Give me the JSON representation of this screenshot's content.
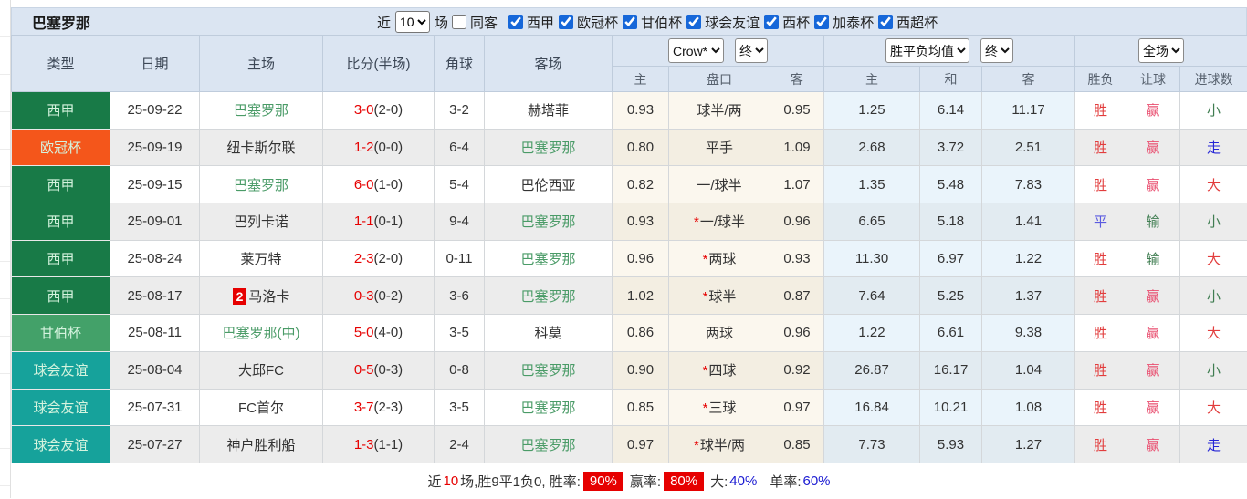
{
  "title": "巴塞罗那",
  "filters": {
    "near_label": "近",
    "near_value": "10",
    "matches_label": "场",
    "same_away": {
      "label": "同客",
      "checked": false
    },
    "leagues": [
      {
        "label": "西甲",
        "checked": true
      },
      {
        "label": "欧冠杯",
        "checked": true
      },
      {
        "label": "甘伯杯",
        "checked": true
      },
      {
        "label": "球会友谊",
        "checked": true
      },
      {
        "label": "西杯",
        "checked": true
      },
      {
        "label": "加泰杯",
        "checked": true
      },
      {
        "label": "西超杯",
        "checked": true
      }
    ]
  },
  "selectors": {
    "provider": "Crow*",
    "provider_time": "终",
    "avg_metric": "胜平负均值",
    "avg_time": "终",
    "scope": "全场"
  },
  "columns": {
    "type": "类型",
    "date": "日期",
    "home": "主场",
    "score": "比分(半场)",
    "corner": "角球",
    "away": "客场",
    "sub": [
      "主",
      "盘口",
      "客",
      "主",
      "和",
      "客",
      "胜负",
      "让球",
      "进球数"
    ]
  },
  "colors": {
    "laliga": "#187a47",
    "ucl": "#f4561b",
    "gamper": "#43a169",
    "friendly": "#16a29b",
    "type_text": "#d5f3de",
    "team_highlight": "#4a9b67",
    "score_red": "#e60000",
    "result_red": "#e23d3d",
    "result_pink": "#e94f70",
    "result_green": "#3f7d51",
    "result_blue": "#5b5be0",
    "result_go_blue": "#2424d6",
    "rate_badge_bg": "#e60000",
    "rate_blue": "#1a1ad2",
    "header_bg": "#dbe5f2"
  },
  "rows": [
    {
      "type": {
        "label": "西甲",
        "key": "laliga"
      },
      "date": "25-09-22",
      "home": {
        "name": "巴塞罗那",
        "highlight": true,
        "badge": ""
      },
      "score": {
        "full": "3-0",
        "half": "(2-0)"
      },
      "corner": "3-2",
      "away": {
        "name": "赫塔菲",
        "highlight": false
      },
      "crow": {
        "home": "0.93",
        "line": "球半/两",
        "star": false,
        "away": "0.95"
      },
      "avg": {
        "home": "1.25",
        "draw": "6.14",
        "away": "11.17"
      },
      "result": {
        "outcome": {
          "t": "胜",
          "c": "red"
        },
        "handicap": {
          "t": "赢",
          "c": "pink"
        },
        "goals": {
          "t": "小",
          "c": "green"
        }
      }
    },
    {
      "type": {
        "label": "欧冠杯",
        "key": "ucl"
      },
      "date": "25-09-19",
      "home": {
        "name": "纽卡斯尔联",
        "highlight": false,
        "badge": ""
      },
      "score": {
        "full": "1-2",
        "half": "(0-0)"
      },
      "corner": "6-4",
      "away": {
        "name": "巴塞罗那",
        "highlight": true
      },
      "crow": {
        "home": "0.80",
        "line": "平手",
        "star": false,
        "away": "1.09"
      },
      "avg": {
        "home": "2.68",
        "draw": "3.72",
        "away": "2.51"
      },
      "result": {
        "outcome": {
          "t": "胜",
          "c": "red"
        },
        "handicap": {
          "t": "赢",
          "c": "pink"
        },
        "goals": {
          "t": "走",
          "c": "go"
        }
      }
    },
    {
      "type": {
        "label": "西甲",
        "key": "laliga"
      },
      "date": "25-09-15",
      "home": {
        "name": "巴塞罗那",
        "highlight": true,
        "badge": ""
      },
      "score": {
        "full": "6-0",
        "half": "(1-0)"
      },
      "corner": "5-4",
      "away": {
        "name": "巴伦西亚",
        "highlight": false
      },
      "crow": {
        "home": "0.82",
        "line": "一/球半",
        "star": false,
        "away": "1.07"
      },
      "avg": {
        "home": "1.35",
        "draw": "5.48",
        "away": "7.83"
      },
      "result": {
        "outcome": {
          "t": "胜",
          "c": "red"
        },
        "handicap": {
          "t": "赢",
          "c": "pink"
        },
        "goals": {
          "t": "大",
          "c": "red"
        }
      }
    },
    {
      "type": {
        "label": "西甲",
        "key": "laliga"
      },
      "date": "25-09-01",
      "home": {
        "name": "巴列卡诺",
        "highlight": false,
        "badge": ""
      },
      "score": {
        "full": "1-1",
        "half": "(0-1)"
      },
      "corner": "9-4",
      "away": {
        "name": "巴塞罗那",
        "highlight": true
      },
      "crow": {
        "home": "0.93",
        "line": "一/球半",
        "star": true,
        "away": "0.96"
      },
      "avg": {
        "home": "6.65",
        "draw": "5.18",
        "away": "1.41"
      },
      "result": {
        "outcome": {
          "t": "平",
          "c": "blue"
        },
        "handicap": {
          "t": "输",
          "c": "green"
        },
        "goals": {
          "t": "小",
          "c": "green"
        }
      }
    },
    {
      "type": {
        "label": "西甲",
        "key": "laliga"
      },
      "date": "25-08-24",
      "home": {
        "name": "莱万特",
        "highlight": false,
        "badge": ""
      },
      "score": {
        "full": "2-3",
        "half": "(2-0)"
      },
      "corner": "0-11",
      "away": {
        "name": "巴塞罗那",
        "highlight": true
      },
      "crow": {
        "home": "0.96",
        "line": "两球",
        "star": true,
        "away": "0.93"
      },
      "avg": {
        "home": "11.30",
        "draw": "6.97",
        "away": "1.22"
      },
      "result": {
        "outcome": {
          "t": "胜",
          "c": "red"
        },
        "handicap": {
          "t": "输",
          "c": "green"
        },
        "goals": {
          "t": "大",
          "c": "red"
        }
      }
    },
    {
      "type": {
        "label": "西甲",
        "key": "laliga"
      },
      "date": "25-08-17",
      "home": {
        "name": "马洛卡",
        "highlight": false,
        "badge": "2"
      },
      "score": {
        "full": "0-3",
        "half": "(0-2)"
      },
      "corner": "3-6",
      "away": {
        "name": "巴塞罗那",
        "highlight": true
      },
      "crow": {
        "home": "1.02",
        "line": "球半",
        "star": true,
        "away": "0.87"
      },
      "avg": {
        "home": "7.64",
        "draw": "5.25",
        "away": "1.37"
      },
      "result": {
        "outcome": {
          "t": "胜",
          "c": "red"
        },
        "handicap": {
          "t": "赢",
          "c": "pink"
        },
        "goals": {
          "t": "小",
          "c": "green"
        }
      }
    },
    {
      "type": {
        "label": "甘伯杯",
        "key": "gamper"
      },
      "date": "25-08-11",
      "home": {
        "name": "巴塞罗那(中)",
        "highlight": true,
        "badge": ""
      },
      "score": {
        "full": "5-0",
        "half": "(4-0)"
      },
      "corner": "3-5",
      "away": {
        "name": "科莫",
        "highlight": false
      },
      "crow": {
        "home": "0.86",
        "line": "两球",
        "star": false,
        "away": "0.96"
      },
      "avg": {
        "home": "1.22",
        "draw": "6.61",
        "away": "9.38"
      },
      "result": {
        "outcome": {
          "t": "胜",
          "c": "red"
        },
        "handicap": {
          "t": "赢",
          "c": "pink"
        },
        "goals": {
          "t": "大",
          "c": "red"
        }
      }
    },
    {
      "type": {
        "label": "球会友谊",
        "key": "friendly"
      },
      "date": "25-08-04",
      "home": {
        "name": "大邱FC",
        "highlight": false,
        "badge": ""
      },
      "score": {
        "full": "0-5",
        "half": "(0-3)"
      },
      "corner": "0-8",
      "away": {
        "name": "巴塞罗那",
        "highlight": true
      },
      "crow": {
        "home": "0.90",
        "line": "四球",
        "star": true,
        "away": "0.92"
      },
      "avg": {
        "home": "26.87",
        "draw": "16.17",
        "away": "1.04"
      },
      "result": {
        "outcome": {
          "t": "胜",
          "c": "red"
        },
        "handicap": {
          "t": "赢",
          "c": "pink"
        },
        "goals": {
          "t": "小",
          "c": "green"
        }
      }
    },
    {
      "type": {
        "label": "球会友谊",
        "key": "friendly"
      },
      "date": "25-07-31",
      "home": {
        "name": "FC首尔",
        "highlight": false,
        "badge": ""
      },
      "score": {
        "full": "3-7",
        "half": "(2-3)"
      },
      "corner": "3-5",
      "away": {
        "name": "巴塞罗那",
        "highlight": true
      },
      "crow": {
        "home": "0.85",
        "line": "三球",
        "star": true,
        "away": "0.97"
      },
      "avg": {
        "home": "16.84",
        "draw": "10.21",
        "away": "1.08"
      },
      "result": {
        "outcome": {
          "t": "胜",
          "c": "red"
        },
        "handicap": {
          "t": "赢",
          "c": "pink"
        },
        "goals": {
          "t": "大",
          "c": "red"
        }
      }
    },
    {
      "type": {
        "label": "球会友谊",
        "key": "friendly"
      },
      "date": "25-07-27",
      "home": {
        "name": "神户胜利船",
        "highlight": false,
        "badge": ""
      },
      "score": {
        "full": "1-3",
        "half": "(1-1)"
      },
      "corner": "2-4",
      "away": {
        "name": "巴塞罗那",
        "highlight": true
      },
      "crow": {
        "home": "0.97",
        "line": "球半/两",
        "star": true,
        "away": "0.85"
      },
      "avg": {
        "home": "7.73",
        "draw": "5.93",
        "away": "1.27"
      },
      "result": {
        "outcome": {
          "t": "胜",
          "c": "red"
        },
        "handicap": {
          "t": "赢",
          "c": "pink"
        },
        "goals": {
          "t": "走",
          "c": "go"
        }
      }
    }
  ],
  "summary": {
    "pre": "近",
    "count": "10",
    "mid1": "场,胜9平1负0, 胜率:",
    "win_rate": "90%",
    "mid2": "赢率:",
    "handicap_rate": "80%",
    "big_label": "大:",
    "big_value": "40%",
    "single_label": "单率:",
    "single_value": "60%"
  }
}
